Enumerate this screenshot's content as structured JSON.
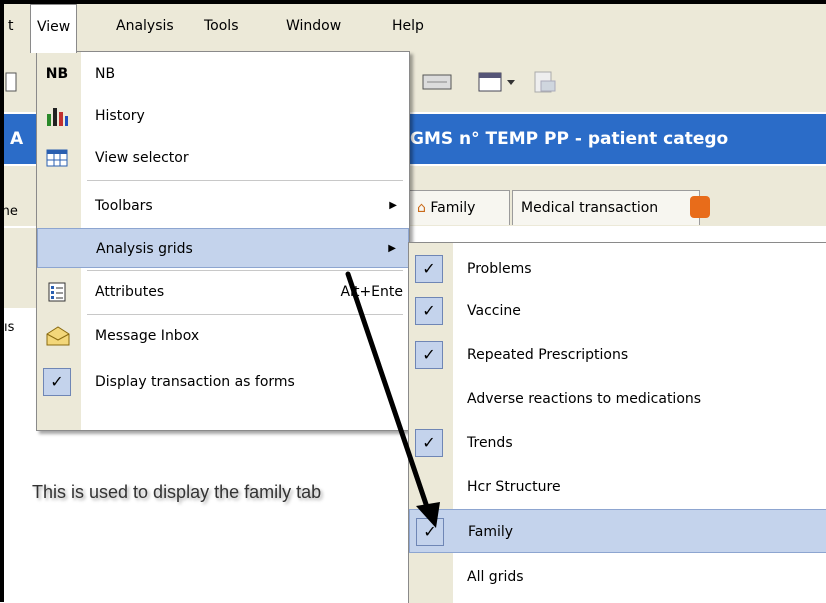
{
  "menubar": {
    "items": [
      "t",
      "View",
      "Analysis",
      "Tools",
      "Window",
      "Help"
    ]
  },
  "titlebar": {
    "left": "A",
    "text": "GMS n° TEMP PP - patient catego"
  },
  "tabs": [
    "Family",
    "Medical transaction"
  ],
  "left_labels": [
    "ine",
    "ıs"
  ],
  "view_menu": {
    "items": [
      {
        "icon_text": "NB",
        "label": "NB",
        "icon": "nb-icon"
      },
      {
        "label": "History",
        "icon": "history-chart-icon"
      },
      {
        "label": "View selector",
        "icon": "grid-selector-icon"
      },
      {
        "label": "Toolbars",
        "icon": ""
      },
      {
        "label": "Analysis grids",
        "icon": ""
      },
      {
        "label": "Attributes",
        "shortcut": "Alt+Ente",
        "icon": "attributes-list-icon"
      },
      {
        "label": "Message Inbox",
        "icon": "envelope-icon"
      },
      {
        "label": "Display transaction as forms",
        "icon": "check-icon"
      }
    ]
  },
  "analysis_grids_menu": {
    "items": [
      {
        "label": "Problems",
        "checked": true
      },
      {
        "label": "Vaccine",
        "checked": true
      },
      {
        "label": "Repeated Prescriptions",
        "checked": true
      },
      {
        "label": "Adverse reactions to medications",
        "checked": false
      },
      {
        "label": "Trends",
        "checked": true
      },
      {
        "label": "Hcr Structure",
        "checked": false
      },
      {
        "label": "Family",
        "checked": true
      },
      {
        "label": "All grids",
        "checked": false
      }
    ]
  },
  "annotation": {
    "text": "This is used to display the family tab"
  },
  "colors": {
    "highlight": "#c4d3ec",
    "title_bar": "#2b6cc8",
    "chrome": "#ece9d8"
  }
}
